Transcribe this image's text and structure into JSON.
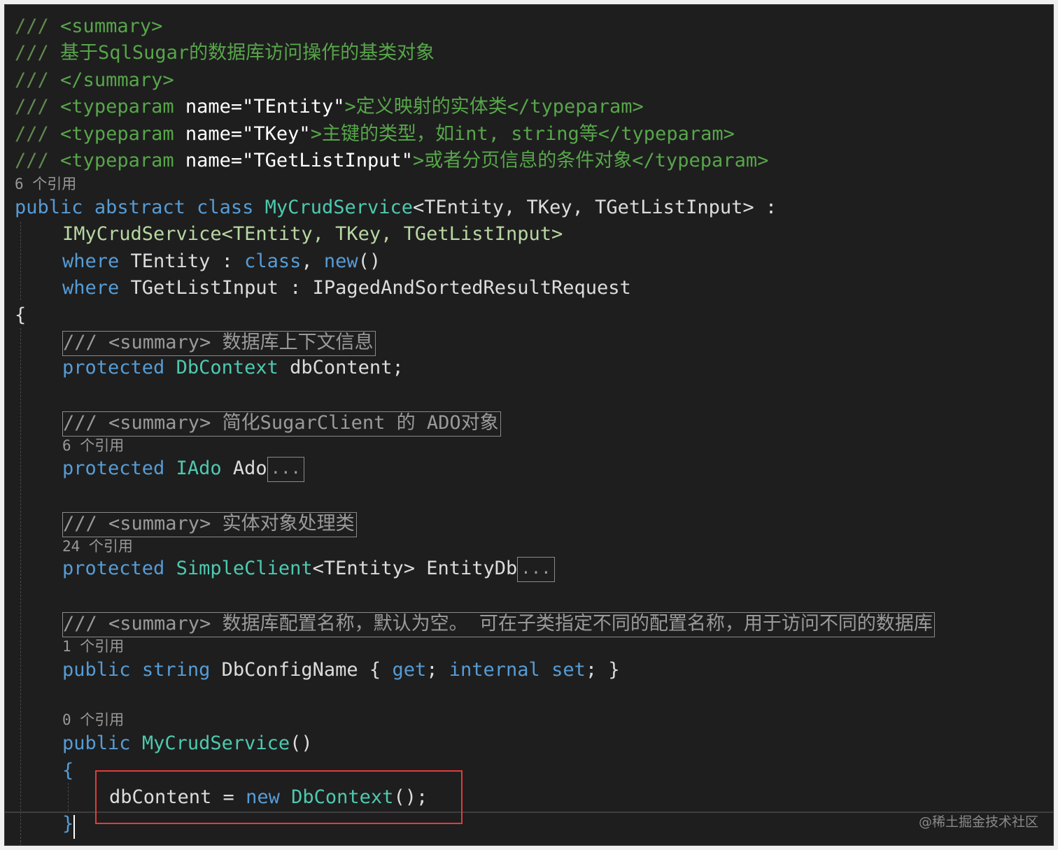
{
  "header_comments": [
    {
      "slashes": "///",
      "tag": "<summary>"
    },
    {
      "slashes": "///",
      "text": "基于SqlSugar的数据库访问操作的基类对象"
    },
    {
      "slashes": "///",
      "tag": "</summary>"
    },
    {
      "slashes": "///",
      "open": "<typeparam",
      "attr": "name=",
      "value": "\"TEntity\"",
      "close_open": ">",
      "text": "定义映射的实体类",
      "end": "</typeparam>"
    },
    {
      "slashes": "///",
      "open": "<typeparam",
      "attr": "name=",
      "value": "\"TKey\"",
      "close_open": ">",
      "text": "主键的类型，如int, string等",
      "end": "</typeparam>"
    },
    {
      "slashes": "///",
      "open": "<typeparam",
      "attr": "name=",
      "value": "\"TGetListInput\"",
      "close_open": ">",
      "text": "或者分页信息的条件对象",
      "end": "</typeparam>"
    }
  ],
  "lens": {
    "class": "6 个引用",
    "ado": "6 个引用",
    "entitydb": "24 个引用",
    "dbconfig": "1 个引用",
    "ctor": "0 个引用"
  },
  "class_decl": {
    "public": "public",
    "abstract": "abstract",
    "class": "class",
    "name": "MyCrudService",
    "generics": "<TEntity, TKey, TGetListInput>",
    "colon": " :"
  },
  "interface_line": "IMyCrudService<TEntity, TKey, TGetListInput>",
  "where1": {
    "kw": "where",
    "text": " TEntity : ",
    "class": "class",
    "comma": ", ",
    "new": "new",
    "parens": "()"
  },
  "where2": {
    "kw": "where",
    "text": " TGetListInput : IPagedAndSortedResultRequest"
  },
  "open_brace": "{",
  "summaries": {
    "dbcontent": "/// <summary> 数据库上下文信息",
    "ado": "/// <summary> 简化SugarClient 的 ADO对象",
    "entitydb": "/// <summary> 实体对象处理类",
    "dbconfig": "/// <summary> 数据库配置名称，默认为空。 可在子类指定不同的配置名称，用于访问不同的数据库"
  },
  "members": {
    "dbcontent": {
      "kw": "protected",
      "type": "DbContext",
      "rest": " dbContent;"
    },
    "ado": {
      "kw": "protected",
      "type": "IAdo",
      "rest": " Ado"
    },
    "entitydb": {
      "kw": "protected",
      "type": "SimpleClient",
      "generic": "<TEntity>",
      "rest": " EntityDb"
    },
    "dbconfig": {
      "kw": "public",
      "type": "string",
      "name": " DbConfigName { ",
      "get": "get",
      "semi1": "; ",
      "internal": "internal",
      "set": "set",
      "end": "; }"
    },
    "ctor": {
      "kw": "public",
      "name": "MyCrudService",
      "parens": "()"
    }
  },
  "collapsed_marker": "...",
  "ctor_open": "{",
  "ctor_body": {
    "lhs": "dbContent = ",
    "kw": "new",
    "type": "DbContext",
    "end": "();"
  },
  "ctor_close": "}",
  "watermark": "@稀土掘金技术社区",
  "colors": {
    "background": "#1e1e1e",
    "comment": "#57a64a",
    "keyword": "#569cd6",
    "type": "#4ec9b0",
    "highlight": "#e23b3b"
  }
}
